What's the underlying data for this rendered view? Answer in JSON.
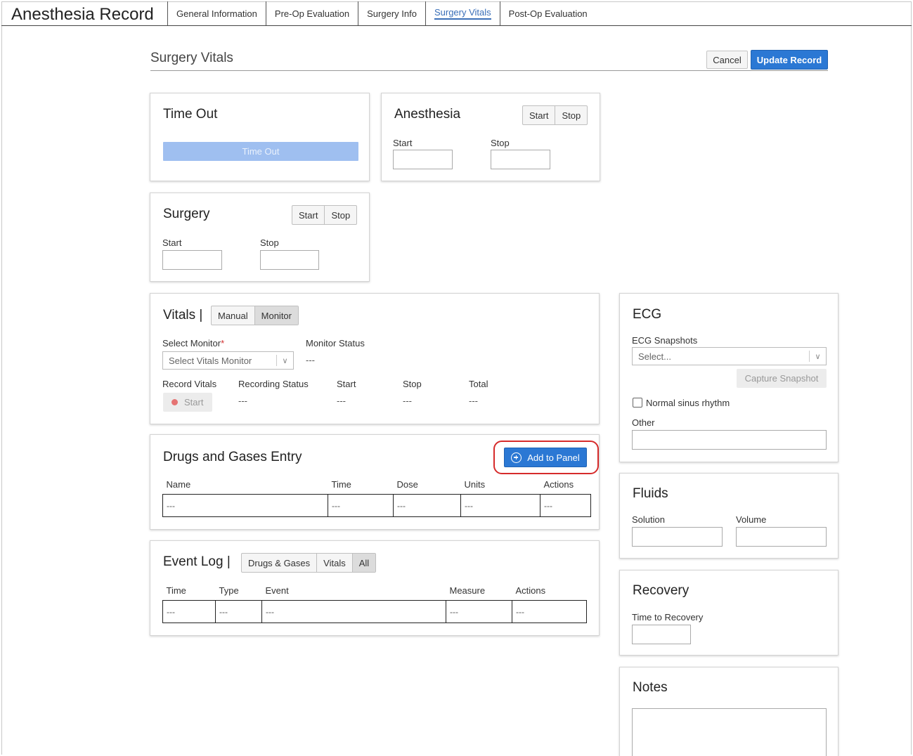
{
  "app": {
    "title": "Anesthesia Record",
    "tabs": [
      {
        "label": "General Information"
      },
      {
        "label": "Pre-Op Evaluation"
      },
      {
        "label": "Surgery Info"
      },
      {
        "label": "Surgery Vitals",
        "active": true
      },
      {
        "label": "Post-Op Evaluation"
      }
    ]
  },
  "page": {
    "title": "Surgery Vitals",
    "cancel_label": "Cancel",
    "update_label": "Update Record"
  },
  "timeout": {
    "title": "Time Out",
    "button_label": "Time Out"
  },
  "anesthesia": {
    "title": "Anesthesia",
    "start_btn": "Start",
    "stop_btn": "Stop",
    "start_label": "Start",
    "stop_label": "Stop"
  },
  "surgery": {
    "title": "Surgery",
    "start_btn": "Start",
    "stop_btn": "Stop",
    "start_label": "Start",
    "stop_label": "Stop"
  },
  "vitals": {
    "title": "Vitals |",
    "mode_manual": "Manual",
    "mode_monitor": "Monitor",
    "select_monitor_label": "Select Monitor",
    "required_mark": "*",
    "select_monitor_placeholder": "Select Vitals Monitor",
    "monitor_status_label": "Monitor Status",
    "monitor_status_value": "---",
    "record_vitals_label": "Record Vitals",
    "record_start_label": "Start",
    "recording_status_label": "Recording Status",
    "recording_status_value": "---",
    "start_label": "Start",
    "start_value": "---",
    "stop_label": "Stop",
    "stop_value": "---",
    "total_label": "Total",
    "total_value": "---"
  },
  "drugs": {
    "title": "Drugs and Gases Entry",
    "add_label": "Add to Panel",
    "columns": [
      "Name",
      "Time",
      "Dose",
      "Units",
      "Actions"
    ],
    "row": [
      "---",
      "---",
      "---",
      "---",
      "---"
    ]
  },
  "eventlog": {
    "title": "Event Log |",
    "filter_drugs": "Drugs & Gases",
    "filter_vitals": "Vitals",
    "filter_all": "All",
    "columns": [
      "Time",
      "Type",
      "Event",
      "Measure",
      "Actions"
    ],
    "row": [
      "---",
      "---",
      "---",
      "---",
      "---"
    ]
  },
  "ecg": {
    "title": "ECG",
    "snapshots_label": "ECG Snapshots",
    "snapshots_placeholder": "Select...",
    "capture_label": "Capture Snapshot",
    "normal_sinus_label": "Normal sinus rhythm",
    "other_label": "Other"
  },
  "fluids": {
    "title": "Fluids",
    "solution_label": "Solution",
    "volume_label": "Volume"
  },
  "recovery": {
    "title": "Recovery",
    "time_label": "Time to Recovery"
  },
  "notes": {
    "title": "Notes"
  }
}
